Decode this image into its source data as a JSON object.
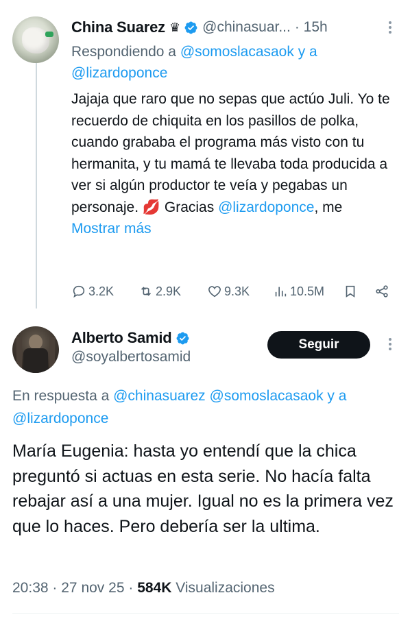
{
  "tweet1": {
    "author_name": "China Suarez",
    "crown": "♛",
    "handle": "@chinasuar...",
    "time": "· 15h",
    "reply_prefix": "Respondiendo a",
    "reply_user1": "@somoslacasaok",
    "reply_and": "y a",
    "reply_user2": "@lizardoponce",
    "text_part1": "Jajaja que raro que no sepas que actúo Juli. Yo te recuerdo de chiquita en los pasillos de polka, cuando grababa el programa más visto con tu hermanita, y tu mamá te llevaba toda producida a ver si algún productor te veía y pegabas un personaje. 💋 Gracias ",
    "text_mention": "@lizardoponce",
    "text_part2": ", me",
    "show_more": "Mostrar más",
    "replies": "3.2K",
    "retweets": "2.9K",
    "likes": "9.3K",
    "views": "10.5M"
  },
  "tweet2": {
    "author_name": "Alberto Samid",
    "handle": "@soyalbertosamid",
    "follow_label": "Seguir",
    "reply_prefix": "En respuesta a",
    "reply_user1": "@chinasuarez",
    "reply_user2": "@somoslacasaok",
    "reply_and": "y a",
    "reply_user3": "@lizardoponce",
    "text": "María Eugenia: hasta yo entendí que la chica preguntó si actuas en esta serie. No hacía falta rebajar así a una mujer. Igual no es la primera vez que lo haces. Pero debería ser la ultima.",
    "time": "20:38",
    "date": "27 nov 25",
    "views_count": "584K",
    "views_label": "Visualizaciones"
  },
  "colors": {
    "accent": "#1d9bf0",
    "text": "#0f1419",
    "secondary": "#536471",
    "verified": "#1d9bf0"
  },
  "icons": {
    "reply": "reply-icon",
    "retweet": "retweet-icon",
    "like": "heart-icon",
    "views": "views-icon",
    "bookmark": "bookmark-icon",
    "share": "share-icon",
    "verified": "verified-badge-icon"
  }
}
